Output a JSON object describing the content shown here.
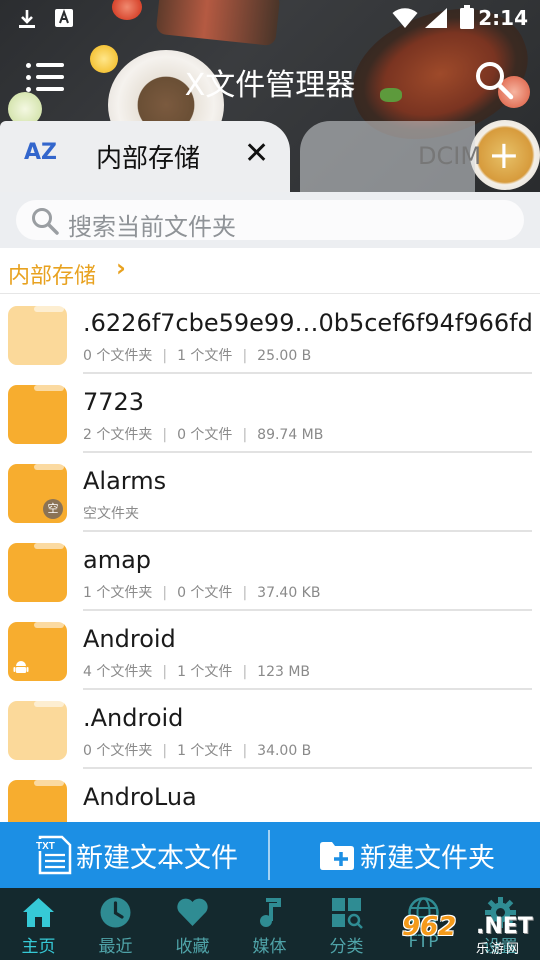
{
  "status_bar": {
    "time": "2:14",
    "icons": [
      "download-icon",
      "font-a-icon",
      "wifi-icon",
      "signal-icon",
      "battery-icon"
    ]
  },
  "toolbar": {
    "title": "X文件管理器",
    "menu_icon": "menu-icon",
    "search_icon": "search-icon"
  },
  "tabs": {
    "sort_label": "AZ",
    "items": [
      {
        "label": "内部存储",
        "active": true
      },
      {
        "label": "DCIM",
        "active": false
      }
    ],
    "add_label": "+"
  },
  "search": {
    "placeholder": "搜索当前文件夹"
  },
  "breadcrumb": {
    "label": "内部存储"
  },
  "files": [
    {
      "name": ".6226f7cbe59e99…0b5cef6f94f966fd",
      "folders": "0 个文件夹",
      "files": "1 个文件",
      "size": "25.00 B",
      "light": true
    },
    {
      "name": "7723",
      "folders": "2 个文件夹",
      "files": "0 个文件",
      "size": "89.74 MB",
      "light": false
    },
    {
      "name": "Alarms",
      "empty_text": "空文件夹",
      "badge": "空",
      "light": false
    },
    {
      "name": "amap",
      "folders": "1 个文件夹",
      "files": "0 个文件",
      "size": "37.40 KB",
      "light": false
    },
    {
      "name": "Android",
      "folders": "4 个文件夹",
      "files": "1 个文件",
      "size": "123 MB",
      "light": false,
      "android": true
    },
    {
      "name": ".Android",
      "folders": "0 个文件夹",
      "files": "1 个文件",
      "size": "34.00 B",
      "light": true
    },
    {
      "name": "AndroLua",
      "folders": "",
      "files": "",
      "size": "",
      "light": false
    }
  ],
  "actions": {
    "new_text_file": "新建文本文件",
    "new_folder": "新建文件夹",
    "txt_icon_label": "TXT"
  },
  "bottom_nav": [
    {
      "label": "主页",
      "icon": "home-icon",
      "active": true
    },
    {
      "label": "最近",
      "icon": "clock-icon",
      "active": false
    },
    {
      "label": "收藏",
      "icon": "heart-icon",
      "active": false
    },
    {
      "label": "媒体",
      "icon": "music-icon",
      "active": false
    },
    {
      "label": "分类",
      "icon": "category-icon",
      "active": false
    },
    {
      "label": "FTP",
      "icon": "globe-icon",
      "active": false
    },
    {
      "label": "设置",
      "icon": "gear-icon",
      "active": false
    }
  ],
  "watermark": {
    "number": "962",
    "domain": ".NET",
    "text": "乐游网"
  },
  "colors": {
    "accent_blue": "#1c8fe4",
    "folder_orange": "#f7ad2f",
    "folder_light": "#fbd99a",
    "breadcrumb_orange": "#e8a220",
    "nav_bg": "#14292e",
    "nav_active": "#36c9d6"
  }
}
